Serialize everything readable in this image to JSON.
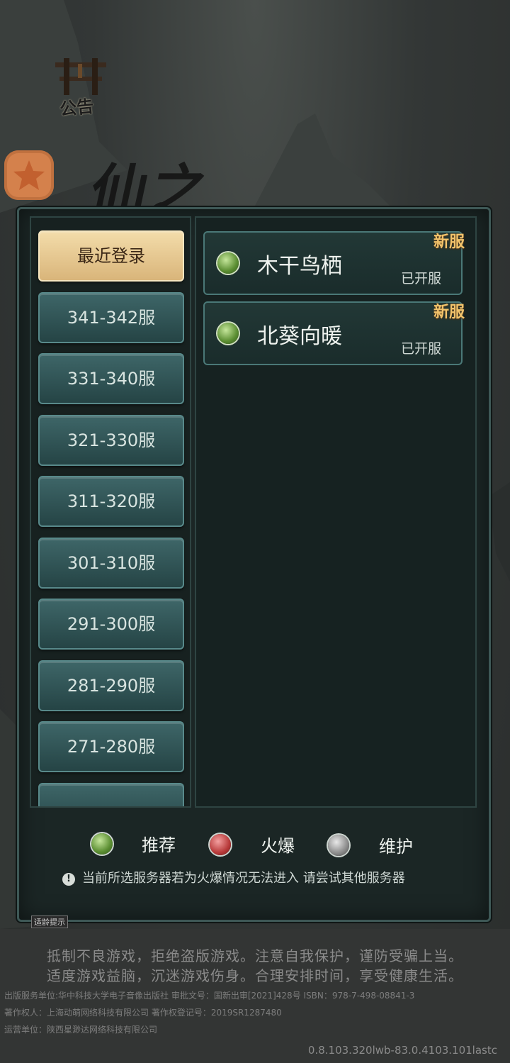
{
  "notice": {
    "label": "公告"
  },
  "game_title": "仙之",
  "sidebar": {
    "items": [
      {
        "label": "最近登录",
        "active": true
      },
      {
        "label": "341-342服"
      },
      {
        "label": "331-340服"
      },
      {
        "label": "321-330服"
      },
      {
        "label": "311-320服"
      },
      {
        "label": "301-310服"
      },
      {
        "label": "291-300服"
      },
      {
        "label": "281-290服"
      },
      {
        "label": "271-280服"
      }
    ]
  },
  "servers": [
    {
      "name": "木干鸟栖",
      "status": "已开服",
      "tag": "新服",
      "state": "推荐"
    },
    {
      "name": "北葵向暖",
      "status": "已开服",
      "tag": "新服",
      "state": "推荐"
    }
  ],
  "legend": [
    {
      "label": "推荐",
      "color": "#6b9a3a"
    },
    {
      "label": "火爆",
      "color": "#b83a3a"
    },
    {
      "label": "维护",
      "color": "#8a8a8a"
    }
  ],
  "tip": "当前所选服务器若为火爆情况无法进入 请尝试其他服务器",
  "age_badge": "适龄提示",
  "health_notice": [
    "抵制不良游戏，拒绝盗版游戏。注意自我保护，谨防受骗上当。",
    "适度游戏益脑，沉迷游戏伤身。合理安排时间，享受健康生活。"
  ],
  "credits": [
    "出版服务单位:华中科技大学电子音像出版社 审批文号：国新出审[2021]428号 ISBN：978-7-498-08841-3",
    "著作权人：上海动萌网络科技有限公司 著作权登记号：2019SR1287480",
    "运营单位：陕西星渺达网络科技有限公司"
  ],
  "version": "0.8.103.320lwb-83.0.4103.101lastc"
}
